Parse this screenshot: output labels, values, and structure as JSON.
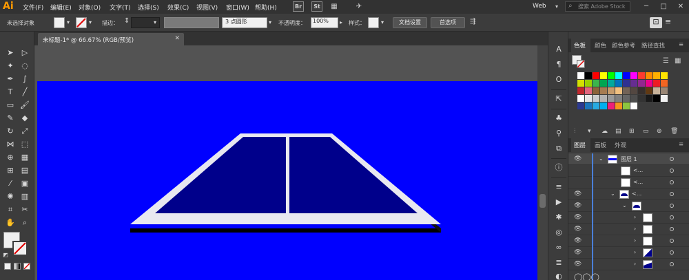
{
  "app": {
    "logo": "Ai"
  },
  "menu": [
    "文件(F)",
    "编辑(E)",
    "对象(O)",
    "文字(T)",
    "选择(S)",
    "效果(C)",
    "视图(V)",
    "窗口(W)",
    "帮助(H)"
  ],
  "bridge": {
    "br": "Br",
    "st": "St"
  },
  "workspace": "Web",
  "search": {
    "placeholder": "搜索 Adobe Stock"
  },
  "controlbar": {
    "selection_status": "未选择对象",
    "stroke_label": "描边：",
    "brush_value": "3 点圆形",
    "opacity_label": "不透明度：",
    "opacity_value": "100%",
    "style_label": "样式：",
    "doc_setup_button": "文档设置",
    "prefs_button": "首选项"
  },
  "document": {
    "tab_title": "未标题-1* @ 66.67% (RGB/预览)"
  },
  "colors": {
    "artboard_bg": "#0000FF",
    "court_fill": "#00008B",
    "court_lines": "#E8E8F0",
    "accent": "#FF9A00"
  },
  "swatches_panel": {
    "tabs": [
      "色板",
      "颜色",
      "颜色参考",
      "路径查找"
    ],
    "swatch_colors": [
      [
        "#ffffff",
        "#000000",
        "#ff0000",
        "#ffff00",
        "#00ff00",
        "#00ffff",
        "#0000ff",
        "#ff00ff",
        "#ff3b30",
        "#ff8c00",
        "#ffb000",
        "#ffe400"
      ],
      [
        "#d4e000",
        "#9bd000",
        "#3cb44b",
        "#00a651",
        "#00a99d",
        "#0072bc",
        "#2e3192",
        "#662d91",
        "#92278f",
        "#ec008c",
        "#ed1c24",
        "#f26522"
      ],
      [
        "#c1272d",
        "#e2657d",
        "#8c6239",
        "#a67c52",
        "#c69c6d",
        "#f0c080",
        "#736357",
        "#534741",
        "#362f2d",
        "#603913",
        "#c7b299",
        "#998675"
      ],
      [
        "#ffffff",
        "#e6e6e6",
        "#cccccc",
        "#b3b3b3",
        "#999999",
        "#808080",
        "#666666",
        "#4d4d4d",
        "#333333",
        "#1a1a1a",
        "#000000",
        "#f2f2f2"
      ],
      [
        "#2b3990",
        "#1b75bc",
        "#27aae1",
        "#00aeef",
        "#ed1e79",
        "#f7941d",
        "#8dc63f",
        "#ffffff"
      ]
    ]
  },
  "layers_panel": {
    "tabs": [
      "图层",
      "画板",
      "外观"
    ],
    "rows": [
      {
        "name": "图层 1"
      },
      {
        "name": "<..."
      },
      {
        "name": "<..."
      },
      {
        "name": "<..."
      }
    ]
  },
  "chart_data": null
}
